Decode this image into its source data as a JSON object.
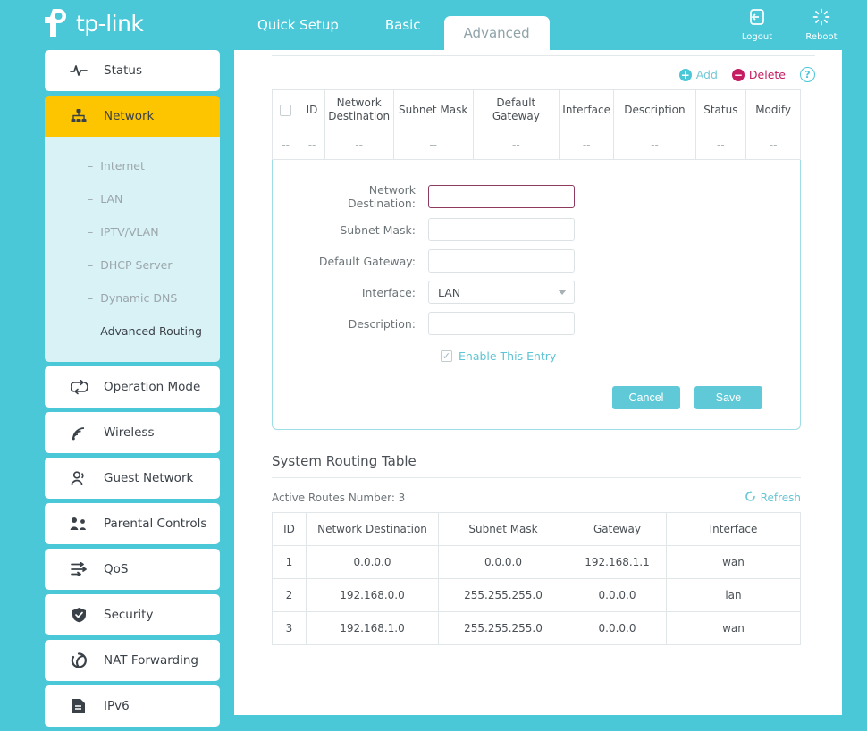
{
  "header": {
    "brand": "tp-link",
    "tabs": [
      {
        "label": "Quick Setup",
        "active": false
      },
      {
        "label": "Basic",
        "active": false
      },
      {
        "label": "Advanced",
        "active": true
      }
    ],
    "actions": [
      {
        "label": "Logout",
        "icon": "logout-icon"
      },
      {
        "label": "Reboot",
        "icon": "reboot-icon"
      }
    ]
  },
  "sidebar": {
    "items": [
      {
        "label": "Status",
        "icon": "pulse-icon",
        "active": false
      },
      {
        "label": "Network",
        "icon": "network-tree-icon",
        "active": true
      },
      {
        "label": "Operation Mode",
        "icon": "swap-arrows-icon",
        "active": false
      },
      {
        "label": "Wireless",
        "icon": "wifi-icon",
        "active": false
      },
      {
        "label": "Guest Network",
        "icon": "people-icon",
        "active": false
      },
      {
        "label": "Parental Controls",
        "icon": "parental-icon",
        "active": false
      },
      {
        "label": "QoS",
        "icon": "qos-arrows-icon",
        "active": false
      },
      {
        "label": "Security",
        "icon": "shield-icon",
        "active": false
      },
      {
        "label": "NAT Forwarding",
        "icon": "nat-icon",
        "active": false
      },
      {
        "label": "IPv6",
        "icon": "document-icon",
        "active": false
      }
    ],
    "submenu": [
      {
        "label": "Internet",
        "active": false
      },
      {
        "label": "LAN",
        "active": false
      },
      {
        "label": "IPTV/VLAN",
        "active": false
      },
      {
        "label": "DHCP Server",
        "active": false
      },
      {
        "label": "Dynamic DNS",
        "active": false
      },
      {
        "label": "Advanced Routing",
        "active": true
      }
    ],
    "submenu_dash": "–"
  },
  "main": {
    "table_actions": {
      "add_label": "Add",
      "add_glyph": "+",
      "delete_label": "Delete",
      "delete_glyph": "−",
      "help_glyph": "?"
    },
    "static_routing_table": {
      "headers": [
        "",
        "ID",
        "Network Destination",
        "Subnet Mask",
        "Default Gateway",
        "Interface",
        "Description",
        "Status",
        "Modify"
      ],
      "empty_row": [
        "--",
        "--",
        "--",
        "--",
        "--",
        "--",
        "--",
        "--",
        "--"
      ]
    },
    "form": {
      "fields": [
        {
          "label": "Network Destination:",
          "value": "",
          "type": "text",
          "error": true
        },
        {
          "label": "Subnet Mask:",
          "value": "",
          "type": "text",
          "error": false
        },
        {
          "label": "Default Gateway:",
          "value": "",
          "type": "text",
          "error": false
        },
        {
          "label": "Interface:",
          "value": "LAN",
          "type": "select",
          "error": false
        },
        {
          "label": "Description:",
          "value": "",
          "type": "text",
          "error": false
        }
      ],
      "enable_label": "Enable This Entry",
      "enable_checked": true,
      "enable_glyph": "✓",
      "cancel_label": "Cancel",
      "save_label": "Save"
    },
    "system_routing": {
      "title": "System Routing Table",
      "active_routes_label": "Active Routes Number: 3",
      "refresh_label": "Refresh",
      "headers": [
        "ID",
        "Network Destination",
        "Subnet Mask",
        "Gateway",
        "Interface"
      ],
      "rows": [
        {
          "id": "1",
          "destination": "0.0.0.0",
          "mask": "0.0.0.0",
          "gateway": "192.168.1.1",
          "interface": "wan"
        },
        {
          "id": "2",
          "destination": "192.168.0.0",
          "mask": "255.255.255.0",
          "gateway": "0.0.0.0",
          "interface": "lan"
        },
        {
          "id": "3",
          "destination": "192.168.1.0",
          "mask": "255.255.255.0",
          "gateway": "0.0.0.0",
          "interface": "wan"
        }
      ]
    }
  },
  "colors": {
    "brand_cyan": "#4BC8D8",
    "accent_yellow": "#FDC500",
    "delete_crimson": "#C51C62",
    "error_border": "#8D3A5E",
    "submenu_bg": "#D9F2F5"
  }
}
